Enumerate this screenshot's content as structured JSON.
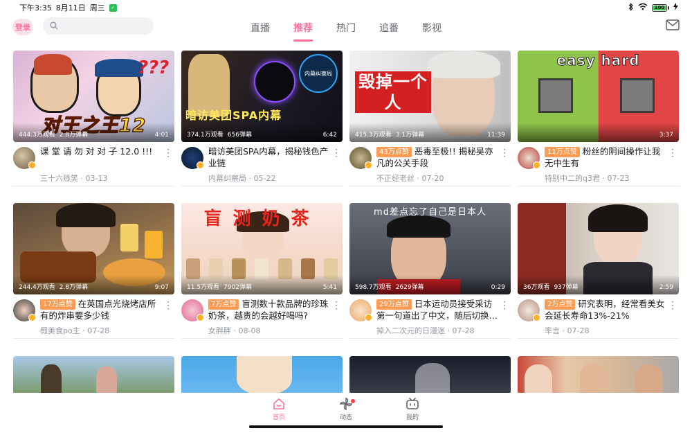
{
  "status_bar": {
    "time": "下午3:35",
    "date": "8月11日",
    "weekday": "周三",
    "battery": "100"
  },
  "header": {
    "login_label": "登录",
    "search_placeholder": "",
    "tabs": [
      {
        "label": "直播",
        "active": false
      },
      {
        "label": "推荐",
        "active": true
      },
      {
        "label": "热门",
        "active": false
      },
      {
        "label": "追番",
        "active": false
      },
      {
        "label": "影视",
        "active": false
      }
    ],
    "accent_color": "#fb7299"
  },
  "videos": [
    {
      "views": "444.3万观看",
      "danmaku": "2.8万弹幕",
      "duration": "4:01",
      "like_tag": "",
      "title": "课 堂 请 勿 对 对 子 12.0 !!!",
      "author": "三十六贱笑",
      "date": "03-13",
      "thumb_text": "对王之王12"
    },
    {
      "views": "374.1万观看",
      "danmaku": "656弹幕",
      "duration": "6:42",
      "like_tag": "",
      "title": "暗访美团SPA内幕，揭秘钱色产业链",
      "author": "内幕纠察局",
      "date": "05-22",
      "thumb_text": "暗访美团SPA内幕"
    },
    {
      "views": "415.3万观看",
      "danmaku": "3.1万弹幕",
      "duration": "11:39",
      "like_tag": "43万点赞",
      "title": "恶毒至极!! 揭秘吴亦凡的公关手段",
      "author": "不正经老丝",
      "date": "07-20",
      "thumb_text": "毁掉一个人"
    },
    {
      "views": "",
      "danmaku": "",
      "duration": "3:37",
      "like_tag": "11万点赞",
      "title": "粉丝的阴间操作让我无中生有",
      "author": "特别中二的q3君",
      "date": "07-23",
      "thumb_text": "easy hard"
    },
    {
      "views": "244.4万观看",
      "danmaku": "2.8万弹幕",
      "duration": "9:07",
      "like_tag": "17万点赞",
      "title": "在英国点光烧烤店所有的炸串要多少钱",
      "author": "假美食po主",
      "date": "07-28",
      "thumb_text": ""
    },
    {
      "views": "11.5万观看",
      "danmaku": "7902弹幕",
      "duration": "5:41",
      "like_tag": "7万点赞",
      "title": "盲测数十款品牌的珍珠奶茶，越贵的会越好喝吗?",
      "author": "女胖胖",
      "date": "08-08",
      "thumb_text": "盲测奶茶"
    },
    {
      "views": "598.7万观看",
      "danmaku": "2629弹幕",
      "duration": "0:29",
      "like_tag": "29万点赞",
      "title": "日本运动员接受采访第一句道出了中文，随后切换…",
      "author": "掉入二次元的日漫迷",
      "date": "07-28",
      "thumb_text": "md差点忘了自己是日本人"
    },
    {
      "views": "36万观看",
      "danmaku": "937弹幕",
      "duration": "2:59",
      "like_tag": "2万点赞",
      "title": "研究表明，经常看美女会延长寿命13%-21%",
      "author": "率言",
      "date": "07-28",
      "thumb_text": ""
    }
  ],
  "bottom_nav": [
    {
      "label": "首页",
      "active": true,
      "icon": "home-icon"
    },
    {
      "label": "动态",
      "active": false,
      "icon": "pinwheel-icon"
    },
    {
      "label": "我的",
      "active": false,
      "icon": "tv-icon"
    }
  ]
}
